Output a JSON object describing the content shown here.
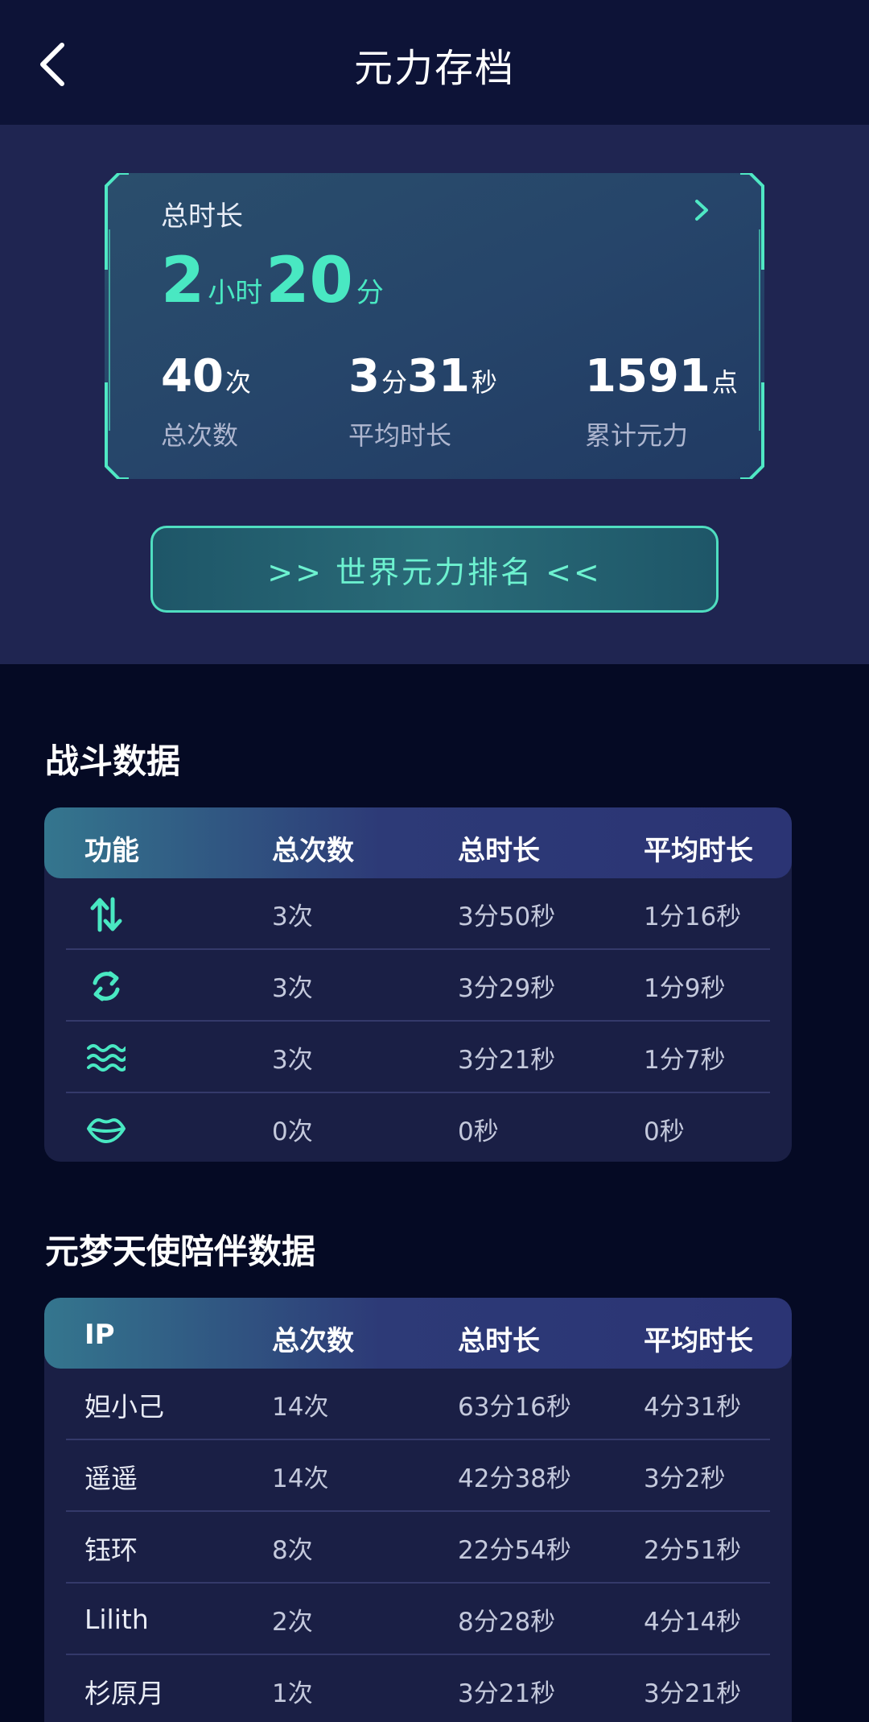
{
  "header": {
    "title": "元力存档"
  },
  "summary": {
    "total_label": "总时长",
    "hours": "2",
    "hours_unit": "小时",
    "minutes": "20",
    "minutes_unit": "分",
    "stats": [
      {
        "value": "40",
        "unit": "次",
        "label": "总次数"
      },
      {
        "value_min": "3",
        "unit_min": "分",
        "value_sec": "31",
        "unit_sec": "秒",
        "label": "平均时长"
      },
      {
        "value": "1591",
        "unit": "点",
        "label": "累计元力"
      }
    ],
    "rank_button": ">> 世界元力排名 <<"
  },
  "battle": {
    "title": "战斗数据",
    "headers": [
      "功能",
      "总次数",
      "总时长",
      "平均时长"
    ],
    "rows": [
      {
        "icon": "up-down-arrows-icon",
        "count": "3次",
        "total": "3分50秒",
        "avg": "1分16秒"
      },
      {
        "icon": "rotate-icon",
        "count": "3次",
        "total": "3分29秒",
        "avg": "1分9秒"
      },
      {
        "icon": "wave-icon",
        "count": "3次",
        "total": "3分21秒",
        "avg": "1分7秒"
      },
      {
        "icon": "lips-icon",
        "count": "0次",
        "total": "0秒",
        "avg": "0秒"
      }
    ]
  },
  "companion": {
    "title": "元梦天使陪伴数据",
    "headers": [
      "IP",
      "总次数",
      "总时长",
      "平均时长"
    ],
    "rows": [
      {
        "name": "妲小己",
        "count": "14次",
        "total": "63分16秒",
        "avg": "4分31秒"
      },
      {
        "name": "遥遥",
        "count": "14次",
        "total": "42分38秒",
        "avg": "3分2秒"
      },
      {
        "name": "钰环",
        "count": "8次",
        "total": "22分54秒",
        "avg": "2分51秒"
      },
      {
        "name": "Lilith",
        "count": "2次",
        "total": "8分28秒",
        "avg": "4分14秒"
      },
      {
        "name": "杉原月",
        "count": "1次",
        "total": "3分21秒",
        "avg": "3分21秒"
      }
    ]
  },
  "colors": {
    "accent": "#49e8c2",
    "background": "#050a24",
    "panel": "#1f2551",
    "table_bg": "#1a1f45"
  }
}
